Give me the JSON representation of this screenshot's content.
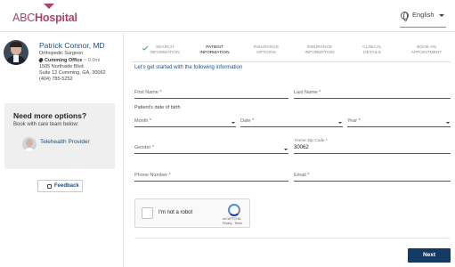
{
  "header": {
    "logo_abc": "ABC",
    "logo_hospital": "Hospital",
    "language": "English"
  },
  "doctor": {
    "name": "Patrick Connor, MD",
    "specialty": "Orthopedic Surgeon",
    "office_name": "Cumming Office",
    "office_distance": "~ 0.0mi",
    "address_line1": "1505 Northside Blvd.",
    "address_line2": "Suite 12 Cumming, GA, 30062",
    "phone": "(404) 785-5252"
  },
  "options": {
    "title": "Need more options?",
    "subtitle": "Book with care team below:",
    "provider_label": "Telehealth Provider"
  },
  "feedback_label": "Feedback",
  "steps": [
    {
      "line1": "Search",
      "line2": "Information",
      "state": "complete"
    },
    {
      "line1": "Patient",
      "line2": "Information",
      "state": "active"
    },
    {
      "line1": "Insurance",
      "line2": "Options",
      "state": "pending"
    },
    {
      "line1": "Insurance",
      "line2": "Information",
      "state": "pending"
    },
    {
      "line1": "Clinical",
      "line2": "Details",
      "state": "pending"
    },
    {
      "line1": "Book an",
      "line2": "Appointment",
      "state": "pending"
    }
  ],
  "form": {
    "intro": "Let's get started with the following information",
    "first_name_placeholder": "First Name *",
    "last_name_placeholder": "Last Name *",
    "dob_label": "Patient's date of birth",
    "month_placeholder": "Month *",
    "date_placeholder": "Date *",
    "year_placeholder": "Year *",
    "gender_placeholder": "Gender *",
    "zip_label": "Home Zip Code *",
    "zip_value": "30062",
    "phone_placeholder": "Phone Number *",
    "email_placeholder": "Email *"
  },
  "captcha": {
    "label": "I'm not a robot",
    "brand": "reCAPTCHA",
    "links": "Privacy - Terms"
  },
  "next_label": "Next",
  "colors": {
    "brand": "#b0416b",
    "link": "#1a4f8a",
    "primary_button": "#123a63",
    "check": "#2aa36b"
  }
}
